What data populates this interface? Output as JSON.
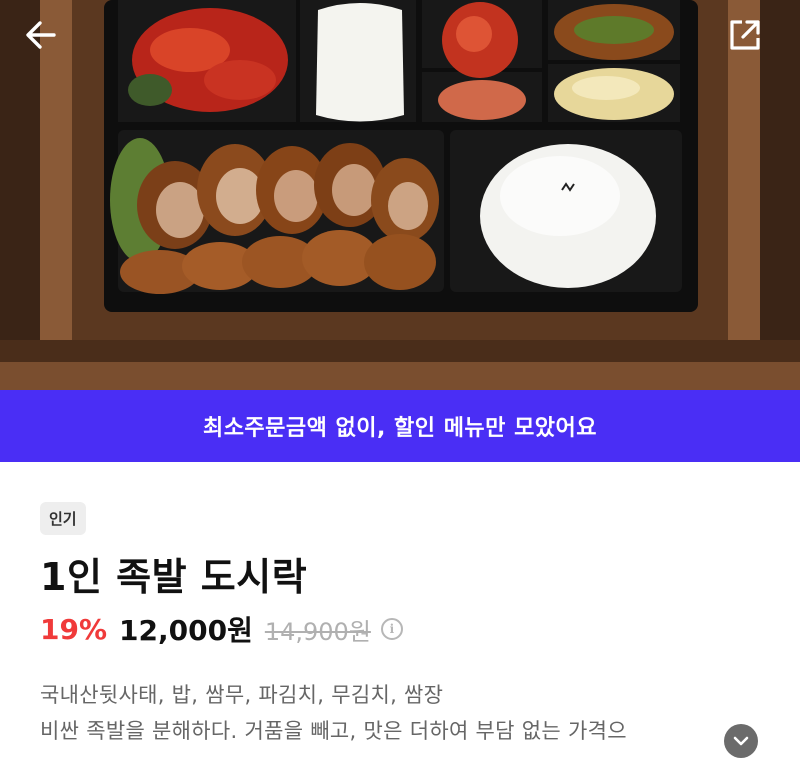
{
  "header": {
    "back_icon": "arrow-left-icon",
    "share_icon": "share-external-icon"
  },
  "hero_image": {
    "description_icon": "food-photo"
  },
  "promo_banner": {
    "text": "최소주문금액 없이, 할인 메뉴만 모았어요",
    "color": "#4a2ef5"
  },
  "product": {
    "badge": "인기",
    "title": "1인 족발 도시락",
    "discount_rate": "19%",
    "price": "12,000원",
    "original_price": "14,900원",
    "discount_color": "#f03a3a",
    "info_icon": "info-circle-icon",
    "description_line1": "국내산뒷사태, 밥, 쌈무, 파김치, 무김치, 쌈장",
    "description_line2": "비싼 족발을 분해하다. 거품을 빼고, 맛은 더하여 부담 없는 가격으",
    "expand_icon": "chevron-down-icon"
  }
}
